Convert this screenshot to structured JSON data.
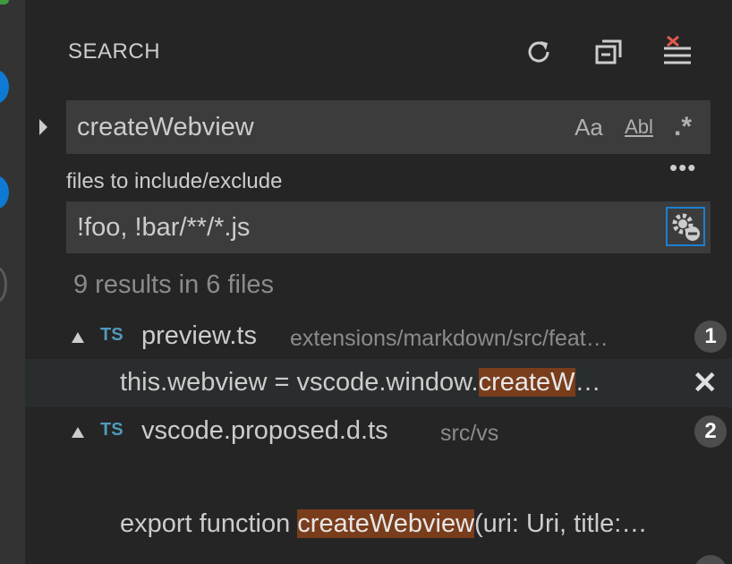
{
  "header": {
    "title": "SEARCH"
  },
  "search": {
    "query": "createWebview",
    "options": {
      "match_case": "Aa",
      "whole_word": "Abl",
      "regex": ".*"
    }
  },
  "include": {
    "label": "files to include/exclude",
    "value": "!foo, !bar/**/*.js"
  },
  "results": {
    "summary": "9 results in 6 files",
    "files": [
      {
        "icon": "TS",
        "name": "preview.ts",
        "path": "extensions/markdown/src/feat…",
        "count": "1",
        "matches": [
          {
            "before": "this.webview = vscode.window.",
            "highlight": "createW",
            "after": "…"
          }
        ]
      },
      {
        "icon": "TS",
        "name": "vscode.proposed.d.ts",
        "path": "src/vs",
        "count": "2",
        "matches": [
          {
            "before": "export function ",
            "highlight": "createWebview",
            "after": "(uri: Uri, title:…"
          }
        ]
      }
    ]
  },
  "colors": {
    "accent": "#1b7fd4",
    "match_highlight": "#7a3d1c",
    "ts_icon": "#519aba"
  }
}
